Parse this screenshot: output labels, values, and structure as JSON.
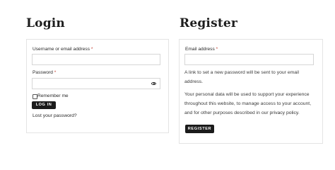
{
  "login": {
    "title": "Login",
    "username_label": "Username or email address",
    "password_label": "Password",
    "required_mark": "*",
    "remember_label": "Remember me",
    "submit_label": "LOG IN",
    "lost_password": "Lost your password?"
  },
  "register": {
    "title": "Register",
    "email_label": "Email address",
    "required_mark": "*",
    "info_text": "A link to set a new password will be sent to your email address.",
    "privacy_text": "Your personal data will be used to support your experience throughout this website, to manage access to your account, and for other purposes described in our",
    "privacy_link": "privacy policy",
    "privacy_end": ".",
    "submit_label": "REGISTER"
  }
}
